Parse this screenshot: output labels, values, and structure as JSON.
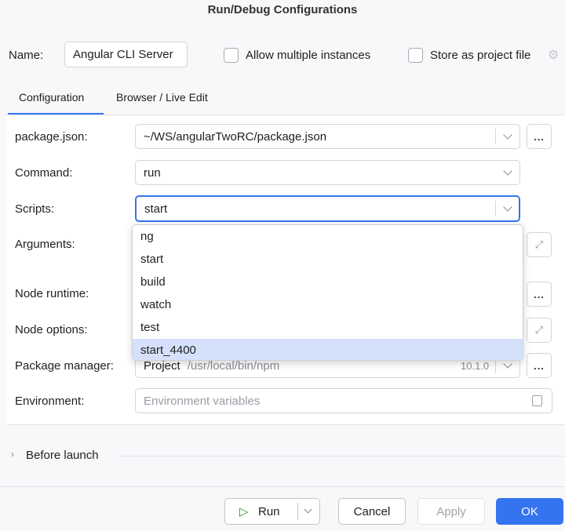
{
  "window": {
    "title": "Run/Debug Configurations"
  },
  "header": {
    "name_label": "Name:",
    "name_value": "Angular CLI Server",
    "allow_multiple_label": "Allow multiple instances",
    "store_project_label": "Store as project file"
  },
  "tabs": [
    {
      "label": "Configuration",
      "active": true
    },
    {
      "label": "Browser / Live Edit",
      "active": false
    }
  ],
  "form": {
    "package_json": {
      "label": "package.json:",
      "value": "~/WS/angularTwoRC/package.json",
      "browse": "..."
    },
    "command": {
      "label": "Command:",
      "value": "run"
    },
    "scripts": {
      "label": "Scripts:",
      "value": "start"
    },
    "arguments": {
      "label": "Arguments:"
    },
    "node_runtime": {
      "label": "Node runtime:",
      "browse": "..."
    },
    "node_options": {
      "label": "Node options:"
    },
    "package_manager": {
      "label": "Package manager:",
      "value": "Project",
      "path": "/usr/local/bin/npm",
      "version": "10.1.0",
      "browse": "..."
    },
    "environment": {
      "label": "Environment:",
      "placeholder": "Environment variables"
    }
  },
  "scripts_dropdown": {
    "options": [
      "ng",
      "start",
      "build",
      "watch",
      "test",
      "start_4400"
    ],
    "highlighted": "start_4400"
  },
  "before_launch": {
    "label": "Before launch"
  },
  "footer": {
    "run": "Run",
    "cancel": "Cancel",
    "apply": "Apply",
    "ok": "OK"
  },
  "colors": {
    "accent": "#3574f0",
    "selection": "#d5e1fb"
  }
}
